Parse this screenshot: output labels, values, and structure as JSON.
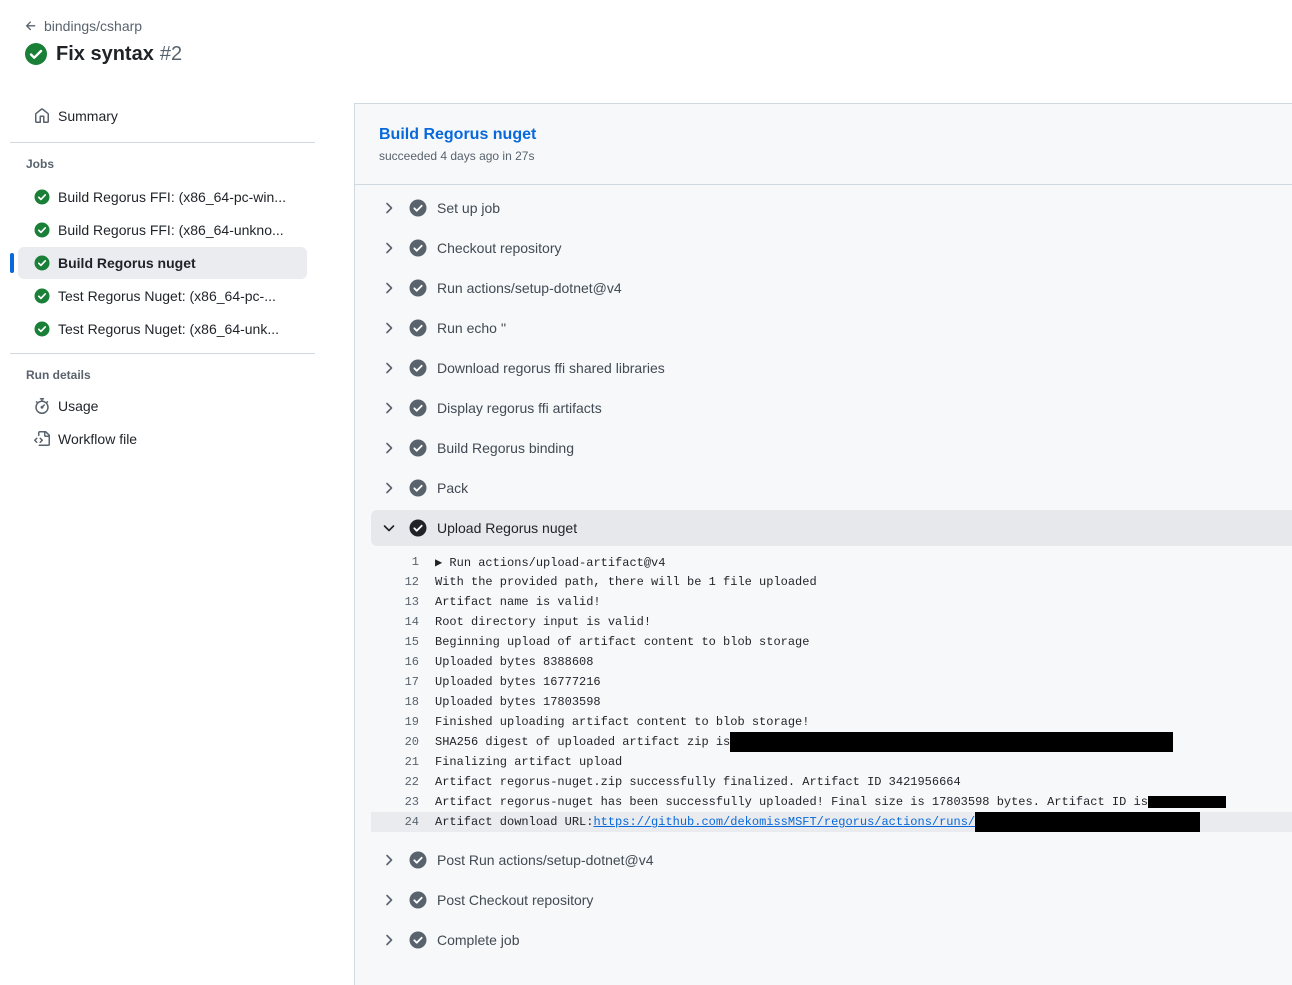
{
  "header": {
    "back_label": "bindings/csharp",
    "run_title": "Fix syntax",
    "run_number": "#2"
  },
  "sidebar": {
    "summary": "Summary",
    "jobs_heading": "Jobs",
    "jobs": [
      {
        "label": "Build Regorus FFI: (x86_64-pc-win..."
      },
      {
        "label": "Build Regorus FFI: (x86_64-unkno..."
      },
      {
        "label": "Build Regorus nuget"
      },
      {
        "label": "Test Regorus Nuget: (x86_64-pc-..."
      },
      {
        "label": "Test Regorus Nuget: (x86_64-unk..."
      }
    ],
    "run_details_heading": "Run details",
    "usage": "Usage",
    "workflow_file": "Workflow file"
  },
  "job": {
    "title": "Build Regorus nuget",
    "subtitle": "succeeded 4 days ago in 27s"
  },
  "steps_before": [
    "Set up job",
    "Checkout repository",
    "Run actions/setup-dotnet@v4",
    "Run echo ''",
    "Download regorus ffi shared libraries",
    "Display regorus ffi artifacts",
    "Build Regorus binding",
    "Pack"
  ],
  "expanded_step": "Upload Regorus nuget",
  "log": [
    {
      "n": "1",
      "text": "▶ Run actions/upload-artifact@v4"
    },
    {
      "n": "12",
      "text": "With the provided path, there will be 1 file uploaded"
    },
    {
      "n": "13",
      "text": "Artifact name is valid!"
    },
    {
      "n": "14",
      "text": "Root directory input is valid!"
    },
    {
      "n": "15",
      "text": "Beginning upload of artifact content to blob storage"
    },
    {
      "n": "16",
      "text": "Uploaded bytes 8388608"
    },
    {
      "n": "17",
      "text": "Uploaded bytes 16777216"
    },
    {
      "n": "18",
      "text": "Uploaded bytes 17803598"
    },
    {
      "n": "19",
      "text": "Finished uploading artifact content to blob storage!"
    },
    {
      "n": "20",
      "text": "SHA256 digest of uploaded artifact zip is "
    },
    {
      "n": "21",
      "text": "Finalizing artifact upload"
    },
    {
      "n": "22",
      "text": "Artifact regorus-nuget.zip successfully finalized. Artifact ID 3421956664"
    },
    {
      "n": "23",
      "text": "Artifact regorus-nuget has been successfully uploaded! Final size is 17803598 bytes. Artifact ID is "
    },
    {
      "n": "24",
      "text": "Artifact download URL: ",
      "link": "https://github.com/dekomissMSFT/regorus/actions/runs/"
    }
  ],
  "steps_after": [
    "Post Run actions/setup-dotnet@v4",
    "Post Checkout repository",
    "Complete job"
  ],
  "colors": {
    "success_green": "#1a7f37",
    "link_blue": "#0969da",
    "step_check_gray": "#59636e"
  }
}
